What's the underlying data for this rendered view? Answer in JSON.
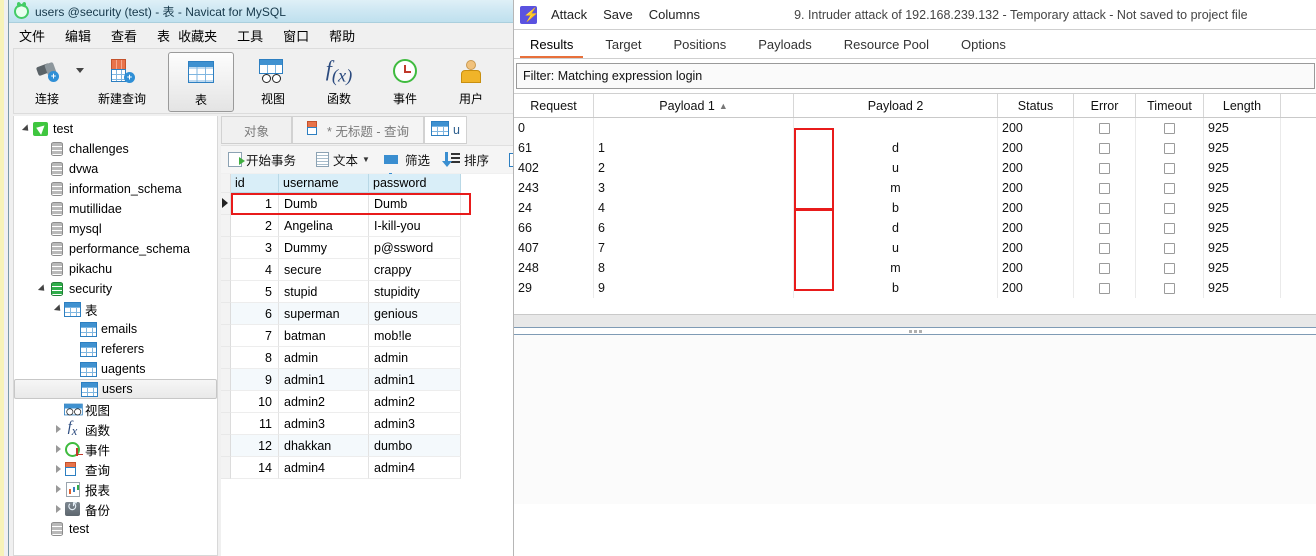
{
  "navicat": {
    "title": "users @security (test) - 表 - Navicat for MySQL",
    "logo_icon": "navicat-logo-icon",
    "menubar": [
      "文件",
      "编辑",
      "查看",
      "表",
      "收藏夹",
      "工具",
      "窗口",
      "帮助"
    ],
    "toolbar": [
      {
        "label": "连接",
        "icon": "plug-add-icon",
        "selected": false,
        "has_caret": true
      },
      {
        "label": "新建查询",
        "icon": "new-query-icon",
        "selected": false,
        "has_caret": false
      },
      {
        "label": "表",
        "icon": "table-grid-icon",
        "selected": true,
        "has_caret": false
      },
      {
        "label": "视图",
        "icon": "view-icon",
        "selected": false,
        "has_caret": false
      },
      {
        "label": "函数",
        "icon": "function-fx-icon",
        "selected": false,
        "has_caret": false
      },
      {
        "label": "事件",
        "icon": "event-clock-icon",
        "selected": false,
        "has_caret": false
      },
      {
        "label": "用户",
        "icon": "user-icon",
        "selected": false,
        "has_caret": false
      }
    ],
    "tree": [
      {
        "label": "test",
        "icon": "navicat-connection-icon",
        "indent": 0,
        "twisty": "open",
        "selected": false
      },
      {
        "label": "challenges",
        "icon": "database-icon",
        "indent": 1,
        "twisty": "none",
        "selected": false
      },
      {
        "label": "dvwa",
        "icon": "database-icon",
        "indent": 1,
        "twisty": "none",
        "selected": false
      },
      {
        "label": "information_schema",
        "icon": "database-icon",
        "indent": 1,
        "twisty": "none",
        "selected": false
      },
      {
        "label": "mutillidae",
        "icon": "database-icon",
        "indent": 1,
        "twisty": "none",
        "selected": false
      },
      {
        "label": "mysql",
        "icon": "database-icon",
        "indent": 1,
        "twisty": "none",
        "selected": false
      },
      {
        "label": "performance_schema",
        "icon": "database-icon",
        "indent": 1,
        "twisty": "none",
        "selected": false
      },
      {
        "label": "pikachu",
        "icon": "database-icon",
        "indent": 1,
        "twisty": "none",
        "selected": false
      },
      {
        "label": "security",
        "icon": "database-green-icon",
        "indent": 1,
        "twisty": "open",
        "selected": false
      },
      {
        "label": "表",
        "icon": "table-grid-icon",
        "indent": 2,
        "twisty": "open",
        "selected": false
      },
      {
        "label": "emails",
        "icon": "table-grid-icon",
        "indent": 3,
        "twisty": "none",
        "selected": false
      },
      {
        "label": "referers",
        "icon": "table-grid-icon",
        "indent": 3,
        "twisty": "none",
        "selected": false
      },
      {
        "label": "uagents",
        "icon": "table-grid-icon",
        "indent": 3,
        "twisty": "none",
        "selected": false
      },
      {
        "label": "users",
        "icon": "table-grid-icon",
        "indent": 3,
        "twisty": "none",
        "selected": true
      },
      {
        "label": "视图",
        "icon": "view-icon",
        "indent": 2,
        "twisty": "none",
        "selected": false
      },
      {
        "label": "函数",
        "icon": "function-fx-icon",
        "indent": 2,
        "twisty": "closed",
        "selected": false
      },
      {
        "label": "事件",
        "icon": "event-clock-icon",
        "indent": 2,
        "twisty": "closed",
        "selected": false
      },
      {
        "label": "查询",
        "icon": "query-icon",
        "indent": 2,
        "twisty": "closed",
        "selected": false
      },
      {
        "label": "报表",
        "icon": "report-icon",
        "indent": 2,
        "twisty": "closed",
        "selected": false
      },
      {
        "label": "备份",
        "icon": "backup-icon",
        "indent": 2,
        "twisty": "closed",
        "selected": false
      },
      {
        "label": "test",
        "icon": "database-icon",
        "indent": 1,
        "twisty": "none",
        "selected": false
      }
    ],
    "tabs": [
      {
        "label": "对象",
        "icon": "none",
        "active": false
      },
      {
        "label": "* 无标题 - 查询",
        "icon": "query-icon",
        "active": false
      },
      {
        "label": "u",
        "icon": "table-grid-icon",
        "active": true
      }
    ],
    "subtoolbar": [
      {
        "label": "开始事务",
        "icon": "begin-transaction-icon"
      },
      {
        "label": "文本",
        "icon": "text-icon",
        "has_caret": true
      },
      {
        "label": "筛选",
        "icon": "filter-funnel-icon"
      },
      {
        "label": "排序",
        "icon": "sort-icon"
      },
      {
        "label": "",
        "icon": "refresh-icon"
      }
    ],
    "grid": {
      "columns": [
        "id",
        "username",
        "password"
      ],
      "rows": [
        {
          "id": "1",
          "username": "Dumb",
          "password": "Dumb",
          "selected": true,
          "highlighted": true
        },
        {
          "id": "2",
          "username": "Angelina",
          "password": "I-kill-you",
          "selected": false,
          "highlighted": false
        },
        {
          "id": "3",
          "username": "Dummy",
          "password": "p@ssword",
          "selected": false,
          "highlighted": false
        },
        {
          "id": "4",
          "username": "secure",
          "password": "crappy",
          "selected": false,
          "highlighted": false
        },
        {
          "id": "5",
          "username": "stupid",
          "password": "stupidity",
          "selected": false,
          "highlighted": false
        },
        {
          "id": "6",
          "username": "superman",
          "password": "genious",
          "selected": false,
          "highlighted": false
        },
        {
          "id": "7",
          "username": "batman",
          "password": "mob!le",
          "selected": false,
          "highlighted": false
        },
        {
          "id": "8",
          "username": "admin",
          "password": "admin",
          "selected": false,
          "highlighted": false
        },
        {
          "id": "9",
          "username": "admin1",
          "password": "admin1",
          "selected": false,
          "highlighted": false
        },
        {
          "id": "10",
          "username": "admin2",
          "password": "admin2",
          "selected": false,
          "highlighted": false
        },
        {
          "id": "11",
          "username": "admin3",
          "password": "admin3",
          "selected": false,
          "highlighted": false
        },
        {
          "id": "12",
          "username": "dhakkan",
          "password": "dumbo",
          "selected": false,
          "highlighted": false
        },
        {
          "id": "14",
          "username": "admin4",
          "password": "admin4",
          "selected": false,
          "highlighted": false
        }
      ]
    }
  },
  "burp": {
    "logo_icon": "burp-lightning-icon",
    "menu": [
      "Attack",
      "Save",
      "Columns"
    ],
    "attack_title": "9. Intruder attack of 192.168.239.132 - Temporary attack - Not saved to project file",
    "tabs": [
      {
        "label": "Results",
        "active": true
      },
      {
        "label": "Target",
        "active": false
      },
      {
        "label": "Positions",
        "active": false
      },
      {
        "label": "Payloads",
        "active": false
      },
      {
        "label": "Resource Pool",
        "active": false
      },
      {
        "label": "Options",
        "active": false
      }
    ],
    "filter": "Filter: Matching expression login",
    "table": {
      "columns": [
        "Request",
        "Payload 1",
        "Payload 2",
        "Status",
        "Error",
        "Timeout",
        "Length"
      ],
      "sorted_column": "Payload 1",
      "sort_direction": "asc",
      "rows": [
        {
          "request": "0",
          "payload1": "",
          "payload2": "",
          "status": "200",
          "error": false,
          "timeout": false,
          "length": "925"
        },
        {
          "request": "61",
          "payload1": "1",
          "payload2": "d",
          "status": "200",
          "error": false,
          "timeout": false,
          "length": "925"
        },
        {
          "request": "402",
          "payload1": "2",
          "payload2": "u",
          "status": "200",
          "error": false,
          "timeout": false,
          "length": "925"
        },
        {
          "request": "243",
          "payload1": "3",
          "payload2": "m",
          "status": "200",
          "error": false,
          "timeout": false,
          "length": "925"
        },
        {
          "request": "24",
          "payload1": "4",
          "payload2": "b",
          "status": "200",
          "error": false,
          "timeout": false,
          "length": "925"
        },
        {
          "request": "66",
          "payload1": "6",
          "payload2": "d",
          "status": "200",
          "error": false,
          "timeout": false,
          "length": "925"
        },
        {
          "request": "407",
          "payload1": "7",
          "payload2": "u",
          "status": "200",
          "error": false,
          "timeout": false,
          "length": "925"
        },
        {
          "request": "248",
          "payload1": "8",
          "payload2": "m",
          "status": "200",
          "error": false,
          "timeout": false,
          "length": "925"
        },
        {
          "request": "29",
          "payload1": "9",
          "payload2": "b",
          "status": "200",
          "error": false,
          "timeout": false,
          "length": "925"
        }
      ],
      "highlight_boxes": [
        {
          "column": "Payload 2",
          "from_row": 1,
          "to_row": 4,
          "color": "#e81b1b"
        },
        {
          "column": "Payload 2",
          "from_row": 5,
          "to_row": 8,
          "color": "#e81b1b"
        }
      ]
    },
    "splitter_icon": "splitter-dots-icon"
  },
  "colors": {
    "burp_accent": "#e8703a",
    "highlight_red": "#e81b1b",
    "navicat_header_blue": "#d9eef8"
  }
}
